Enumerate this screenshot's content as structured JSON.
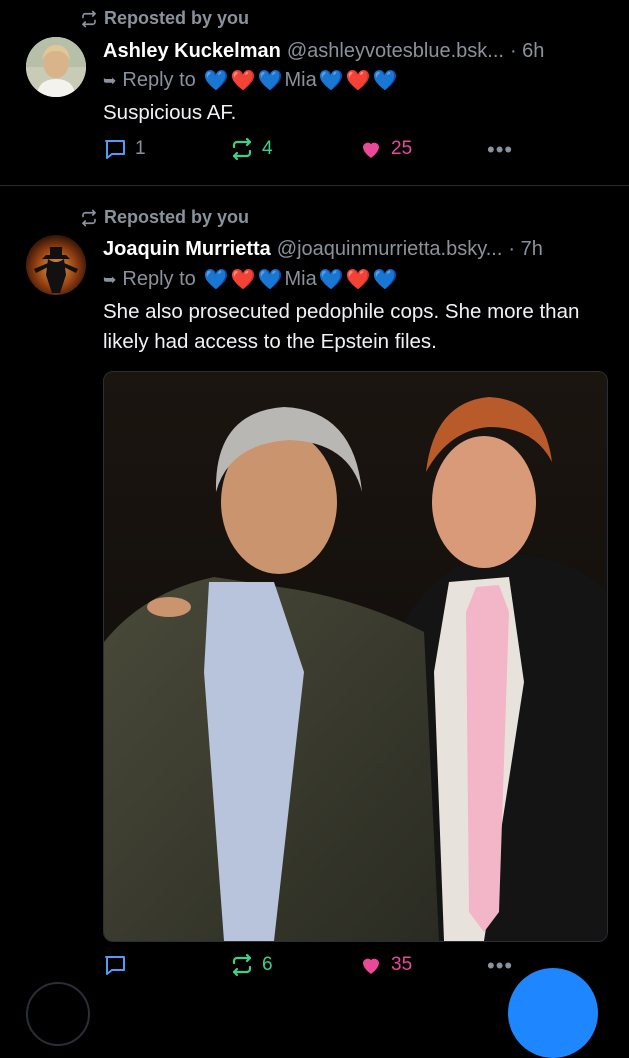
{
  "post1": {
    "repost_label": "Reposted by you",
    "author_name": "Ashley Kuckelman",
    "handle": "@ashleyvotesblue.bsk...",
    "time": "· 6h",
    "reply_prefix": "Reply to",
    "reply_name": "Mia",
    "text": "Suspicious AF.",
    "reply_count": "1",
    "repost_count": "4",
    "like_count": "25"
  },
  "post2": {
    "repost_label": "Reposted by you",
    "author_name": "Joaquin Murrietta",
    "handle": "@joaquinmurrietta.bsky...",
    "time": "· 7h",
    "reply_prefix": "Reply to",
    "reply_name": "Mia",
    "text": "She also prosecuted pedophile cops.  She more than likely had access to the Epstein files.",
    "reply_count": "",
    "repost_count": "6",
    "like_count": "35"
  },
  "colors": {
    "background": "#000000",
    "muted": "#8a929c",
    "repost_green": "#3fd08a",
    "like_pink": "#ec4899",
    "reply_blue": "#4f9cf9",
    "fab_blue": "#1e86ff"
  },
  "icons": {
    "repost": "repost-icon",
    "reply": "reply-icon",
    "like": "heart-icon",
    "more": "more-icon"
  }
}
